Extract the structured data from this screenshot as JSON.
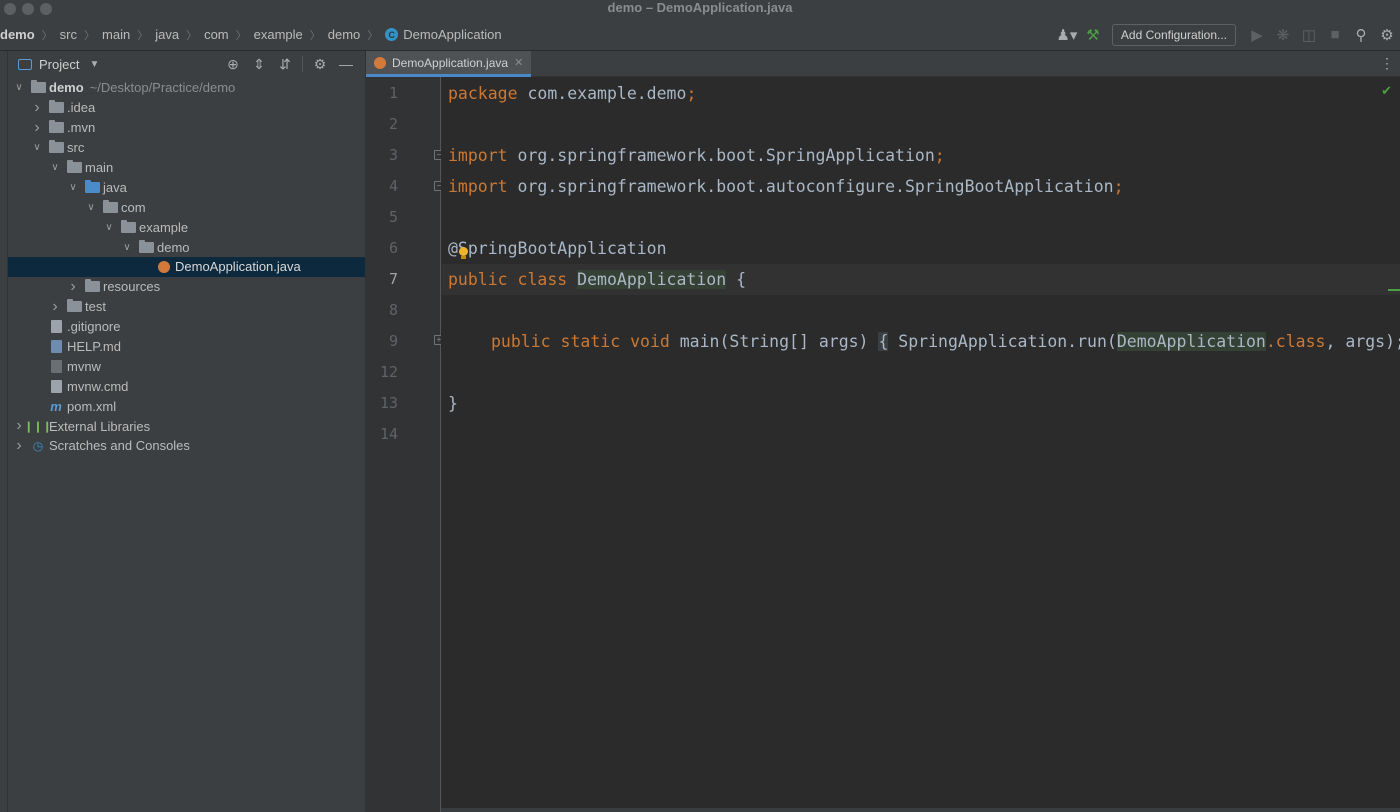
{
  "window": {
    "title": "demo – DemoApplication.java"
  },
  "breadcrumbs": [
    "demo",
    "src",
    "main",
    "java",
    "com",
    "example",
    "demo",
    "DemoApplication"
  ],
  "toolbar": {
    "add_configuration_label": "Add Configuration...",
    "icons": [
      "user-icon",
      "build-hammer-icon",
      "run-icon",
      "debug-icon",
      "coverage-icon",
      "stop-icon",
      "search-icon",
      "settings-icon"
    ]
  },
  "project_panel": {
    "title": "Project",
    "tree": [
      {
        "label": "demo",
        "detail": "~/Desktop/Practice/demo",
        "depth": 0,
        "expanded": true,
        "kind": "module"
      },
      {
        "label": ".idea",
        "depth": 1,
        "expanded": false,
        "kind": "folder"
      },
      {
        "label": ".mvn",
        "depth": 1,
        "expanded": false,
        "kind": "folder"
      },
      {
        "label": "src",
        "depth": 1,
        "expanded": true,
        "kind": "folder"
      },
      {
        "label": "main",
        "depth": 2,
        "expanded": true,
        "kind": "folder"
      },
      {
        "label": "java",
        "depth": 3,
        "expanded": true,
        "kind": "source-folder"
      },
      {
        "label": "com",
        "depth": 4,
        "expanded": true,
        "kind": "folder"
      },
      {
        "label": "example",
        "depth": 5,
        "expanded": true,
        "kind": "folder"
      },
      {
        "label": "demo",
        "depth": 6,
        "expanded": true,
        "kind": "folder"
      },
      {
        "label": "DemoApplication.java",
        "depth": 7,
        "kind": "java",
        "selected": true
      },
      {
        "label": "resources",
        "depth": 3,
        "expanded": false,
        "kind": "folder"
      },
      {
        "label": "test",
        "depth": 2,
        "expanded": false,
        "kind": "folder"
      },
      {
        "label": ".gitignore",
        "depth": 1,
        "kind": "file"
      },
      {
        "label": "HELP.md",
        "depth": 1,
        "kind": "md"
      },
      {
        "label": "mvnw",
        "depth": 1,
        "kind": "exe"
      },
      {
        "label": "mvnw.cmd",
        "depth": 1,
        "kind": "file"
      },
      {
        "label": "pom.xml",
        "depth": 1,
        "kind": "pom"
      },
      {
        "label": "External Libraries",
        "depth": 0,
        "expanded": false,
        "kind": "libraries"
      },
      {
        "label": "Scratches and Consoles",
        "depth": 0,
        "expanded": false,
        "kind": "scratches"
      }
    ]
  },
  "editor": {
    "tab_label": "DemoApplication.java",
    "current_line": "7",
    "line_numbers": [
      "1",
      "2",
      "3",
      "4",
      "5",
      "6",
      "7",
      "8",
      "9",
      "12",
      "13",
      "14"
    ],
    "code": {
      "l1_kw": "package",
      "l1_rest": " com.example.demo",
      "l1_semi": ";",
      "l3_kw": "import",
      "l3_rest": " org.springframework.boot.SpringApplication",
      "l3_semi": ";",
      "l4_kw": "import",
      "l4_rest": " org.springframework.boot.autoconfigure.SpringBootApplication",
      "l4_semi": ";",
      "l6_ann": "@SpringBootApplication",
      "l7_kw": "public class",
      "l7_cls": "DemoApplication",
      "l7_rest": " {",
      "l9_kw": "public static void",
      "l9_sig": " main(String[] args) ",
      "l9_brace": "{",
      "l9_call": " SpringApplication.run(",
      "l9_arg": "DemoApplication",
      "l9_kw2": ".class",
      "l9_tail": ", args); }",
      "l13": "}"
    }
  },
  "colors": {
    "keyword": "#cc7832",
    "annotation": "#bbb529",
    "text": "#a9b7c6",
    "selection": "#0d293e",
    "accent": "#4a88c7"
  }
}
